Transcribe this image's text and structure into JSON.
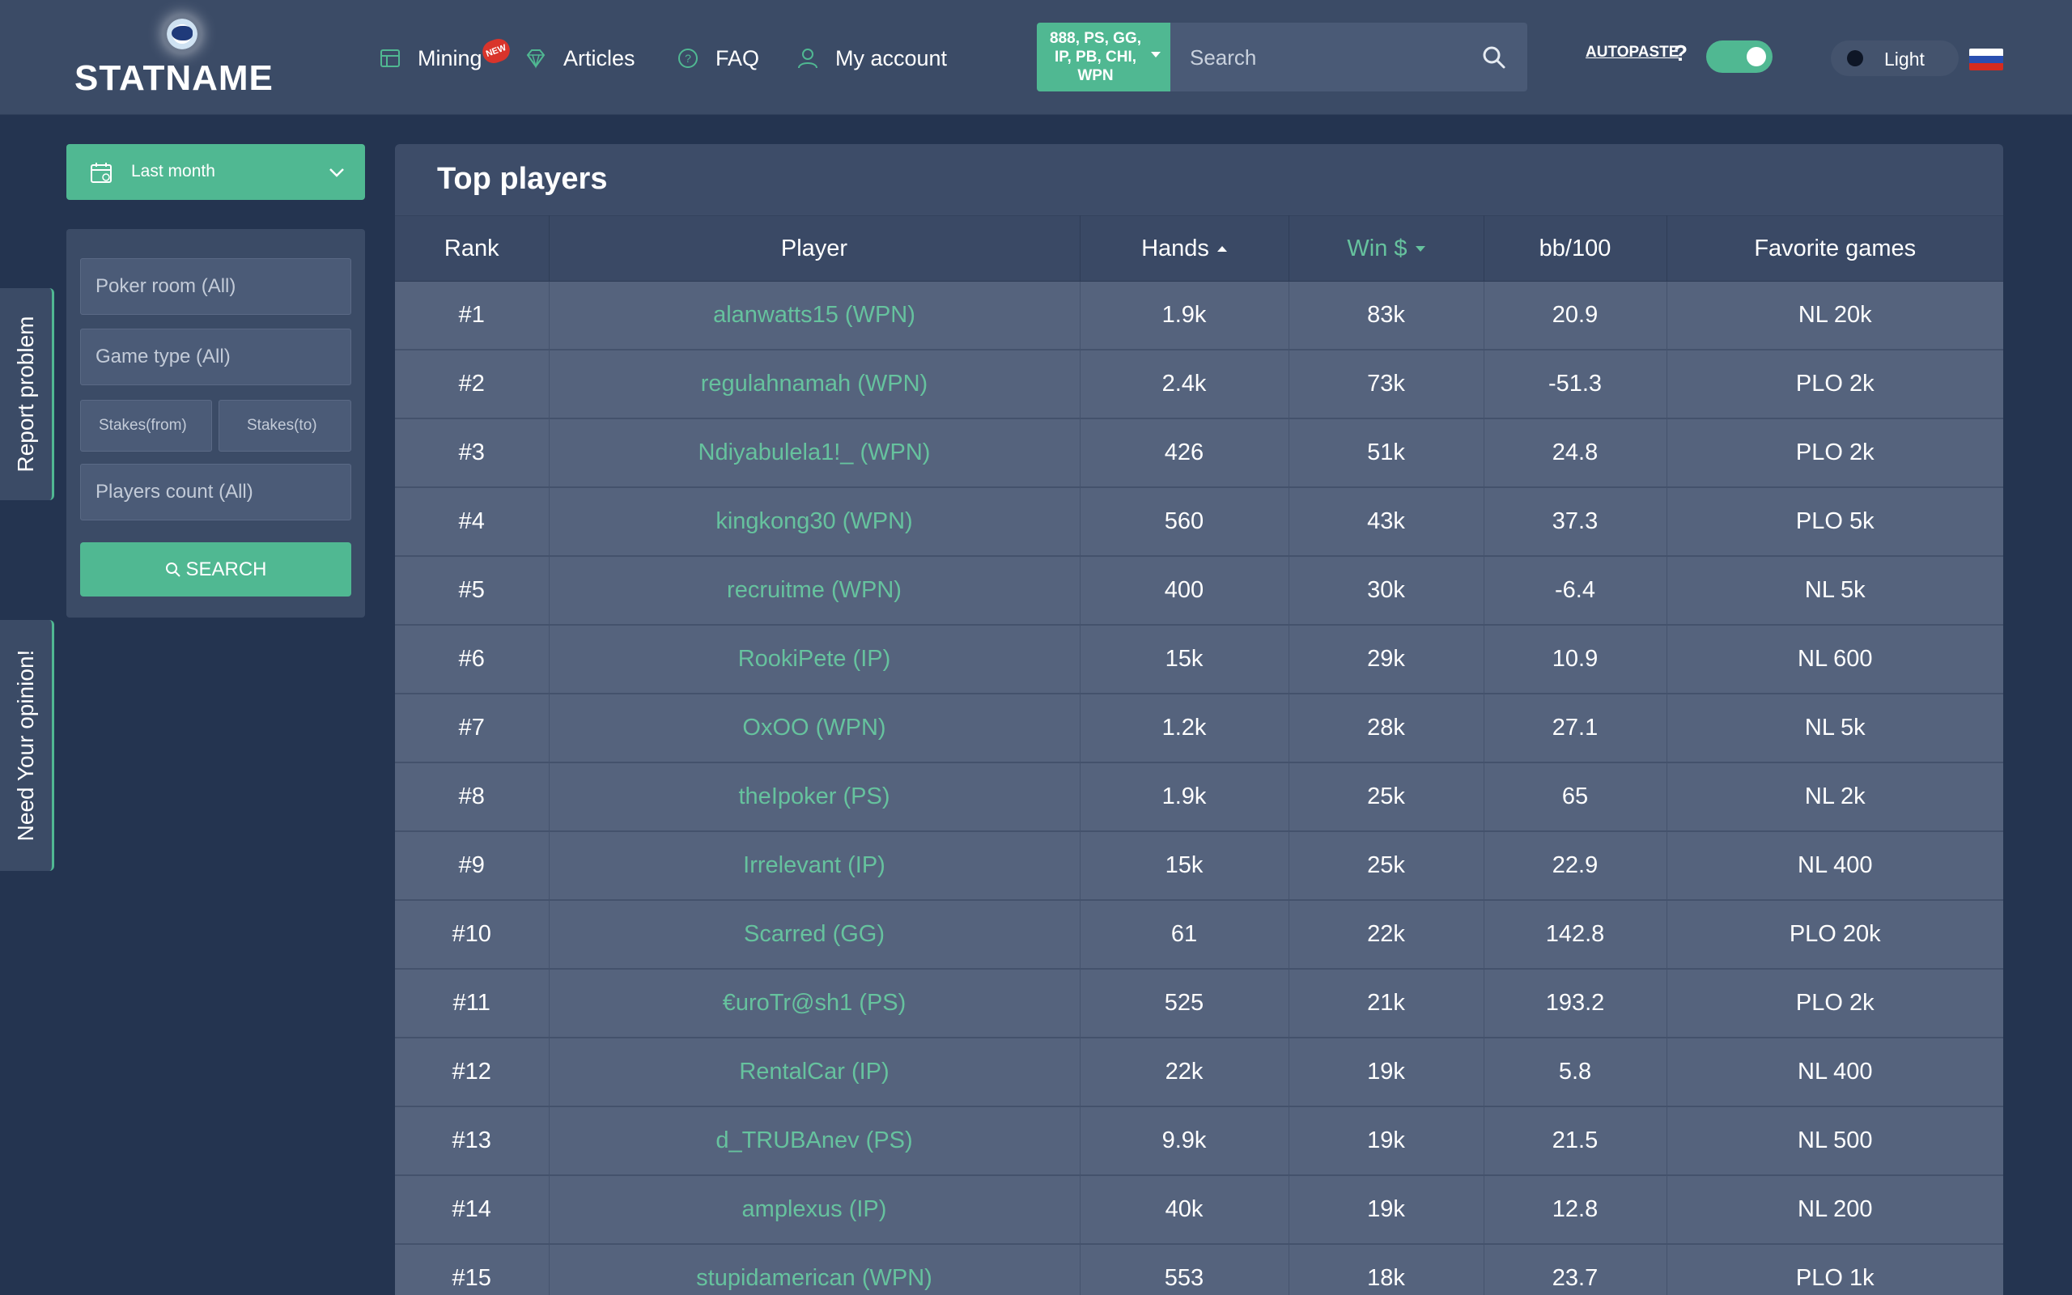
{
  "logo": {
    "text": "STATNAME"
  },
  "nav": {
    "mining": "Mining",
    "mining_badge": "NEW",
    "articles": "Articles",
    "faq": "FAQ",
    "account": "My account"
  },
  "room_select": {
    "value": "888, PS, GG, IP, PB, CHI, WPN"
  },
  "search": {
    "placeholder": "Search"
  },
  "autopaste": {
    "label": "AUTOPASTE",
    "help": "?",
    "enabled": true
  },
  "theme": {
    "label": "Light"
  },
  "side_tabs": {
    "report": "Report problem",
    "opinion": "Need Your opinion!"
  },
  "filters": {
    "period": "Last month",
    "poker_room_placeholder": "Poker room (All)",
    "game_type_placeholder": "Game type (All)",
    "stakes_from_placeholder": "Stakes(from)",
    "stakes_to_placeholder": "Stakes(to)",
    "players_count_placeholder": "Players count (All)",
    "search_button": "SEARCH"
  },
  "table": {
    "title": "Top players",
    "columns": {
      "rank": "Rank",
      "player": "Player",
      "hands": "Hands",
      "win": "Win $",
      "bb100": "bb/100",
      "games": "Favorite games"
    },
    "rows": [
      {
        "rank": "#1",
        "player": "alanwatts15 (WPN)",
        "hands": "1.9k",
        "win": "83k",
        "bb100": "20.9",
        "games": "NL 20k"
      },
      {
        "rank": "#2",
        "player": "regulahnamah (WPN)",
        "hands": "2.4k",
        "win": "73k",
        "bb100": "-51.3",
        "games": "PLO 2k"
      },
      {
        "rank": "#3",
        "player": "Ndiyabulela1!_ (WPN)",
        "hands": "426",
        "win": "51k",
        "bb100": "24.8",
        "games": "PLO 2k"
      },
      {
        "rank": "#4",
        "player": "kingkong30 (WPN)",
        "hands": "560",
        "win": "43k",
        "bb100": "37.3",
        "games": "PLO 5k"
      },
      {
        "rank": "#5",
        "player": "recruitme (WPN)",
        "hands": "400",
        "win": "30k",
        "bb100": "-6.4",
        "games": "NL 5k"
      },
      {
        "rank": "#6",
        "player": "RookiPete (IP)",
        "hands": "15k",
        "win": "29k",
        "bb100": "10.9",
        "games": "NL 600"
      },
      {
        "rank": "#7",
        "player": "OxOO (WPN)",
        "hands": "1.2k",
        "win": "28k",
        "bb100": "27.1",
        "games": "NL 5k"
      },
      {
        "rank": "#8",
        "player": "theIpoker (PS)",
        "hands": "1.9k",
        "win": "25k",
        "bb100": "65",
        "games": "NL 2k"
      },
      {
        "rank": "#9",
        "player": "Irrelevant (IP)",
        "hands": "15k",
        "win": "25k",
        "bb100": "22.9",
        "games": "NL 400"
      },
      {
        "rank": "#10",
        "player": "Scarred (GG)",
        "hands": "61",
        "win": "22k",
        "bb100": "142.8",
        "games": "PLO 20k"
      },
      {
        "rank": "#11",
        "player": "€uroTr@sh1 (PS)",
        "hands": "525",
        "win": "21k",
        "bb100": "193.2",
        "games": "PLO 2k"
      },
      {
        "rank": "#12",
        "player": "RentalCar (IP)",
        "hands": "22k",
        "win": "19k",
        "bb100": "5.8",
        "games": "NL 400"
      },
      {
        "rank": "#13",
        "player": "d_TRUBAnev (PS)",
        "hands": "9.9k",
        "win": "19k",
        "bb100": "21.5",
        "games": "NL 500"
      },
      {
        "rank": "#14",
        "player": "amplexus (IP)",
        "hands": "40k",
        "win": "19k",
        "bb100": "12.8",
        "games": "NL 200"
      },
      {
        "rank": "#15",
        "player": "stupidamerican (WPN)",
        "hands": "553",
        "win": "18k",
        "bb100": "23.7",
        "games": "PLO 1k"
      }
    ]
  },
  "colors": {
    "accent": "#50b892",
    "player_link": "#66c29e",
    "background": "#243450",
    "header": "#3b4b66",
    "row": "#55637d"
  }
}
